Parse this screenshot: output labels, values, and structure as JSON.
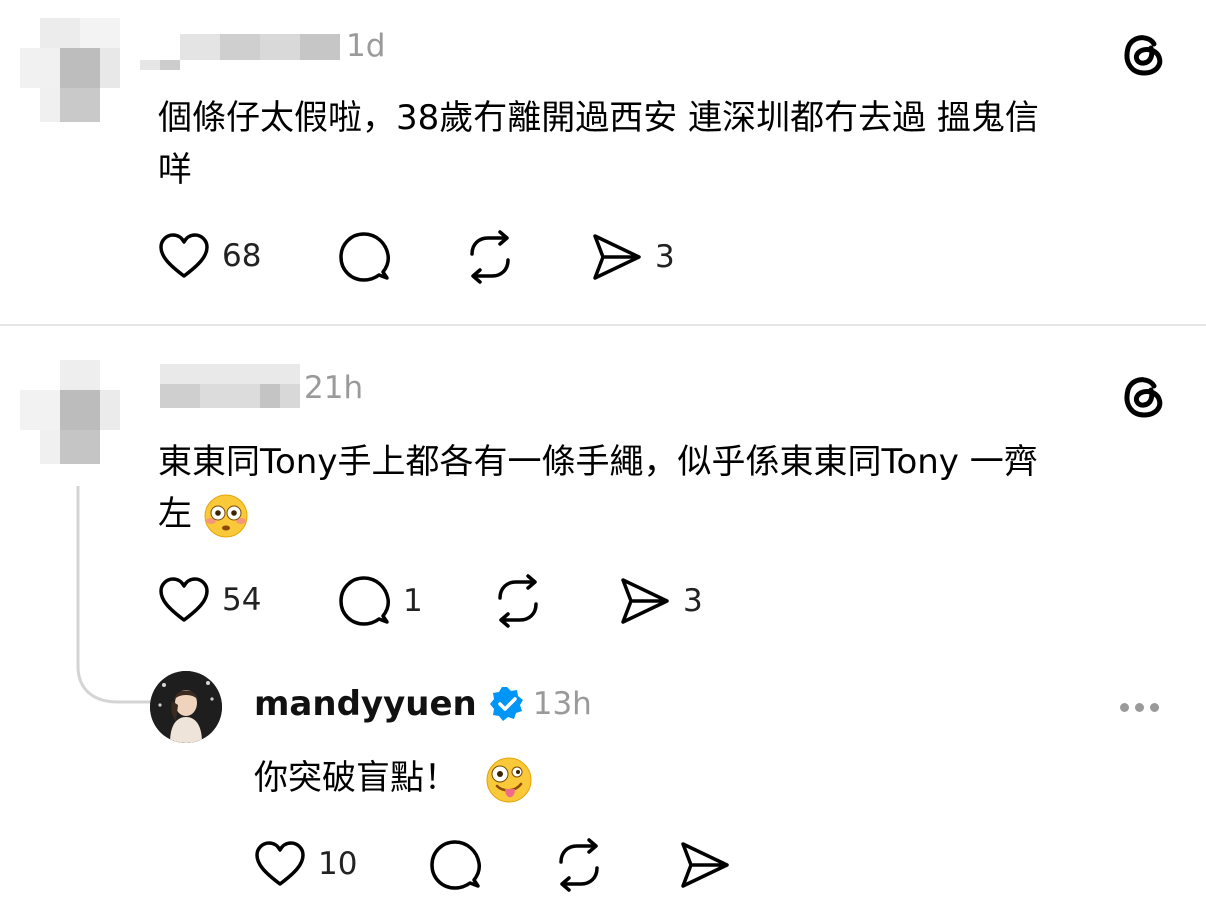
{
  "posts": [
    {
      "time": "1d",
      "text_line1": "個條仔太假啦，38歲冇離開過西安 連深圳都冇去過 搵鬼信",
      "text_line2": "咩",
      "likes": "68",
      "shares": "3"
    },
    {
      "time": "21h",
      "text_line1": "東東同Tony手上都各有一條手繩，似乎係東東同Tony 一齊",
      "text_line2": "左",
      "likes": "54",
      "replies": "1",
      "shares": "3"
    }
  ],
  "reply": {
    "username": "mandyyuen",
    "time": "13h",
    "text": "你突破盲點！",
    "likes": "10"
  },
  "icons": {
    "threads_logo": "threads-logo-icon",
    "verified": "verified-badge-icon",
    "more": "more-options-icon"
  },
  "colors": {
    "verified_blue": "#0095f6",
    "meta_gray": "#9a9a9a"
  }
}
